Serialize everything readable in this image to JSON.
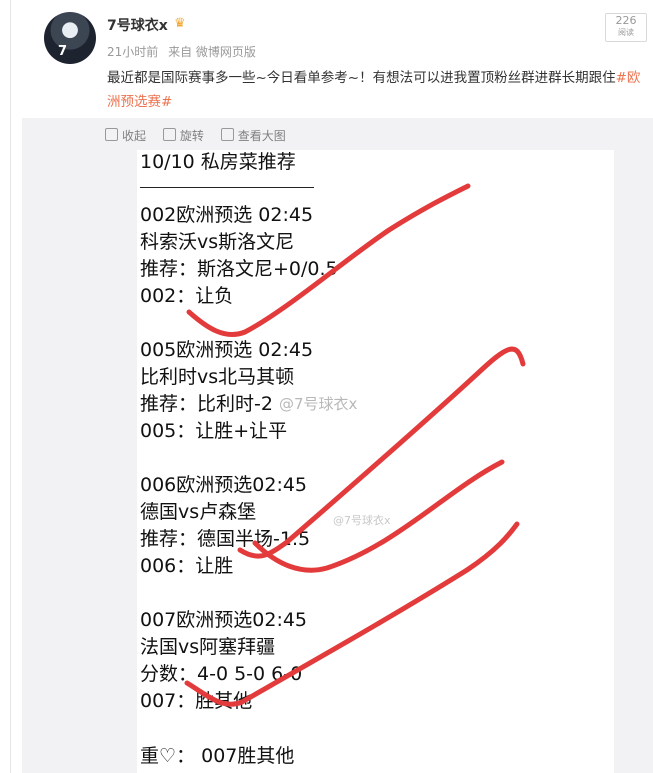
{
  "post": {
    "username": "7号球衣x",
    "time": "21小时前",
    "source": "来自 微博网页版",
    "read_count": "226",
    "read_label": "阅读",
    "text": "最近都是国际赛事多一些~今日看单参考~！有想法可以进我置顶粉丝群进群长期跟住",
    "hashtag": "#欧洲预选赛#"
  },
  "avatar": {
    "jersey_number": "7"
  },
  "toolbar": {
    "collect": "收起",
    "rotate": "旋转",
    "view_large": "查看大图"
  },
  "image": {
    "title": "10/10 私房菜推荐",
    "rule": "———————————",
    "watermark": "@7号球衣x",
    "watermark_small": "@7号球衣x",
    "lines": [
      "002欧洲预选 02:45",
      "科索沃vs斯洛文尼",
      "推荐：斯洛文尼+0/0.5",
      "002：让负",
      "005欧洲预选 02:45",
      "比利时vs北马其顿",
      "推荐：比利时-2",
      "005：让胜+让平",
      "006欧洲预选02:45",
      "德国vs卢森堡",
      "推荐：德国半场-1.5",
      "006：让胜",
      "007欧洲预选02:45",
      "法国vs阿塞拜疆",
      "分数：4-0  5-0  6-0",
      "007：胜其他"
    ],
    "footer_prefix": "重",
    "footer_text": "：  007胜其他"
  },
  "colors": {
    "accent": "#eb7350",
    "scribble": "#e33b3b",
    "crown": "#f2a52c"
  }
}
